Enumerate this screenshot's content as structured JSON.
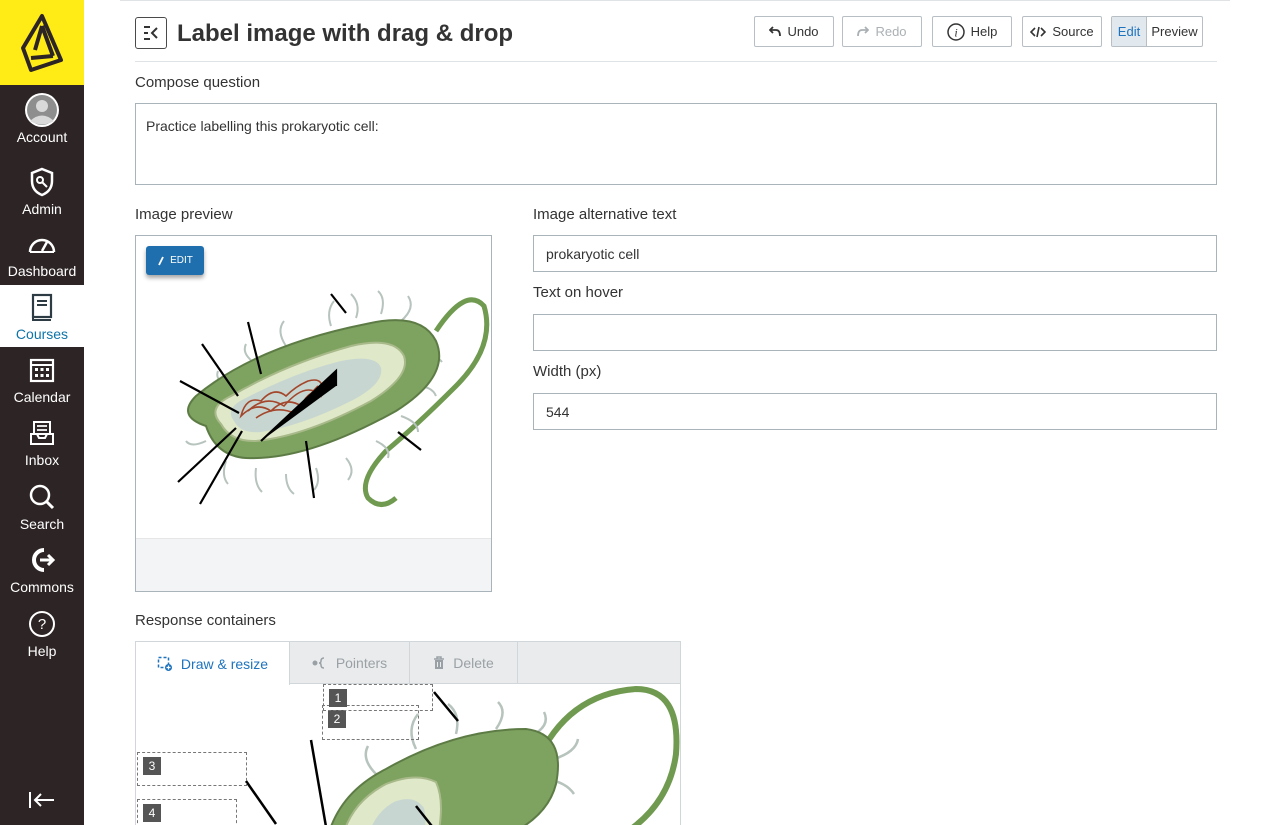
{
  "sidebar": {
    "items": [
      {
        "label": "Account",
        "icon": "account-avatar-icon"
      },
      {
        "label": "Admin",
        "icon": "admin-shield-icon"
      },
      {
        "label": "Dashboard",
        "icon": "dashboard-gauge-icon"
      },
      {
        "label": "Courses",
        "icon": "courses-book-icon",
        "active": true
      },
      {
        "label": "Calendar",
        "icon": "calendar-icon"
      },
      {
        "label": "Inbox",
        "icon": "inbox-icon"
      },
      {
        "label": "Search",
        "icon": "search-icon"
      },
      {
        "label": "Commons",
        "icon": "commons-icon"
      },
      {
        "label": "Help",
        "icon": "help-icon"
      }
    ]
  },
  "header": {
    "title": "Label image with drag & drop",
    "undo_label": "Undo",
    "redo_label": "Redo",
    "help_label": "Help",
    "source_label": "Source",
    "edit_label": "Edit",
    "preview_label": "Preview"
  },
  "compose": {
    "label": "Compose question",
    "text": "Practice labelling this prokaryotic cell:"
  },
  "image_preview": {
    "label": "Image preview",
    "edit_label": "EDIT"
  },
  "image_settings": {
    "alt_label": "Image alternative text",
    "alt_value": "prokaryotic cell",
    "hover_label": "Text on hover",
    "hover_value": "",
    "width_label": "Width (px)",
    "width_value": "544"
  },
  "response_containers": {
    "label": "Response containers",
    "tabs": [
      {
        "label": "Draw & resize",
        "active": true
      },
      {
        "label": "Pointers"
      },
      {
        "label": "Delete"
      }
    ],
    "boxes": [
      "1",
      "2",
      "3",
      "4"
    ]
  },
  "colors": {
    "sidebar_bg": "#2d2425",
    "logo_bg": "#ffec17",
    "accent": "#0e74a8",
    "edit_button": "#1f6fae"
  }
}
